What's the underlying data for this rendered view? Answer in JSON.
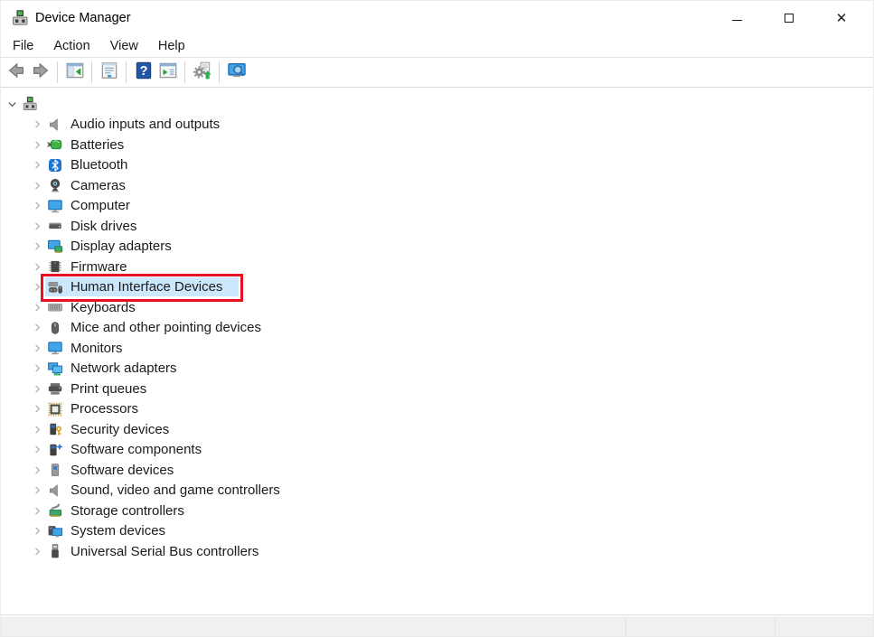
{
  "window": {
    "title": "Device Manager",
    "app_icon": "device-manager",
    "controls": [
      {
        "name": "minimize"
      },
      {
        "name": "maximize"
      },
      {
        "name": "close"
      }
    ]
  },
  "menu": {
    "items": [
      "File",
      "Action",
      "View",
      "Help"
    ]
  },
  "toolbar": {
    "buttons": [
      {
        "name": "back"
      },
      {
        "name": "forward"
      },
      {
        "name": "show-console-tree"
      },
      {
        "name": "properties"
      },
      {
        "name": "help"
      },
      {
        "name": "show-action-pane"
      },
      {
        "name": "scan-for-hardware-changes"
      },
      {
        "name": "search-devices"
      }
    ]
  },
  "tree": {
    "root": {
      "label": "",
      "icon": "computer-root",
      "expanded": true
    },
    "items": [
      {
        "label": "Audio inputs and outputs",
        "icon": "speaker"
      },
      {
        "label": "Batteries",
        "icon": "battery"
      },
      {
        "label": "Bluetooth",
        "icon": "bluetooth"
      },
      {
        "label": "Cameras",
        "icon": "camera"
      },
      {
        "label": "Computer",
        "icon": "monitor"
      },
      {
        "label": "Disk drives",
        "icon": "disk"
      },
      {
        "label": "Display adapters",
        "icon": "display-adapter"
      },
      {
        "label": "Firmware",
        "icon": "firmware"
      },
      {
        "label": "Human Interface Devices",
        "icon": "hid",
        "selected": true,
        "annotated": true
      },
      {
        "label": "Keyboards",
        "icon": "keyboard"
      },
      {
        "label": "Mice and other pointing devices",
        "icon": "mouse"
      },
      {
        "label": "Monitors",
        "icon": "monitor"
      },
      {
        "label": "Network adapters",
        "icon": "network"
      },
      {
        "label": "Print queues",
        "icon": "printer"
      },
      {
        "label": "Processors",
        "icon": "processor"
      },
      {
        "label": "Security devices",
        "icon": "security"
      },
      {
        "label": "Software components",
        "icon": "software-component"
      },
      {
        "label": "Software devices",
        "icon": "software-device"
      },
      {
        "label": "Sound, video and game controllers",
        "icon": "speaker"
      },
      {
        "label": "Storage controllers",
        "icon": "storage"
      },
      {
        "label": "System devices",
        "icon": "system"
      },
      {
        "label": "Universal Serial Bus controllers",
        "icon": "usb"
      }
    ]
  },
  "statusbar": {
    "sections": [
      "",
      "",
      ""
    ]
  },
  "colors": {
    "selection": "#cce8ff",
    "annotation_red": "#e81123",
    "accent_blue": "#42a5e8"
  }
}
